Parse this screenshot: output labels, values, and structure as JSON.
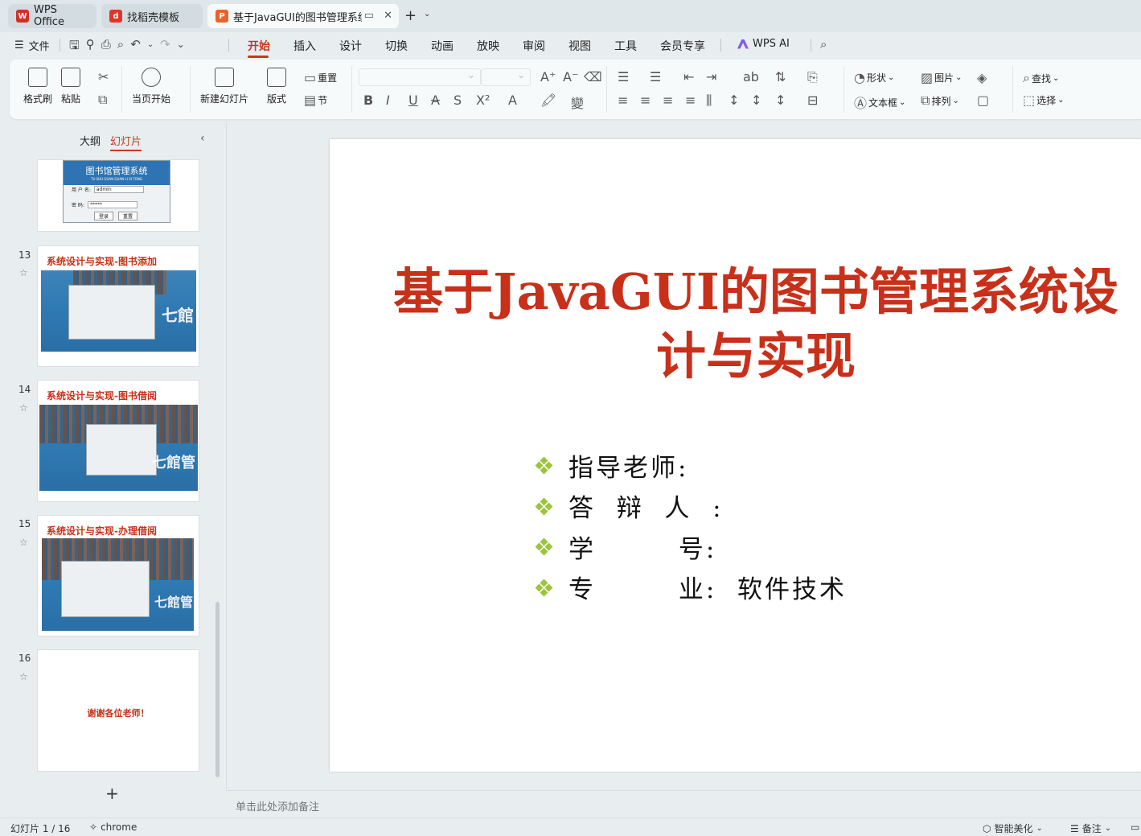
{
  "tabs": [
    {
      "label": "WPS Office",
      "icon": "wps-logo-icon",
      "color": "#d0302a"
    },
    {
      "label": "找稻壳模板",
      "icon": "docer-logo-icon",
      "color": "#e0342b"
    },
    {
      "label": "基于JavaGUI的图书管理系统",
      "icon": "presentation-logo-icon",
      "color": "#e8642c"
    }
  ],
  "menu": {
    "file_label": "文件",
    "items": [
      "开始",
      "插入",
      "设计",
      "切换",
      "动画",
      "放映",
      "审阅",
      "视图",
      "工具",
      "会员专享"
    ],
    "active": "开始",
    "ai_label": "WPS AI"
  },
  "ribbon": {
    "format_painter": "格式刷",
    "paste": "粘贴",
    "start_from_current": "当页开始",
    "new_slide": "新建幻灯片",
    "layout": "版式",
    "section": "节",
    "reset": "重置",
    "shape": "形状",
    "picture": "图片",
    "textbox": "文本框",
    "arrange": "排列",
    "find": "查找",
    "select": "选择"
  },
  "left_panel": {
    "tab_outline": "大纲",
    "tab_slides": "幻灯片",
    "thumbnails": [
      {
        "number": "",
        "title": "",
        "login_title": "图书馆管理系统",
        "login_sub": "TU SHU GUAN GUAN LI XI TONG",
        "user_label": "用 户 名:",
        "user_value": "admin",
        "pwd_label": "密    码:",
        "pwd_value": "*****",
        "btn_login": "登录",
        "btn_reset": "重置"
      },
      {
        "number": "13",
        "title": "系统设计与实现-图书添加"
      },
      {
        "number": "14",
        "title": "系统设计与实现-图书借阅"
      },
      {
        "number": "15",
        "title": "系统设计与实现-办理借阅"
      },
      {
        "number": "16",
        "title": "",
        "body": "谢谢各位老师！"
      }
    ]
  },
  "slide": {
    "title_line1": "基于JavaGUI的图书管理系统设",
    "title_line2": "计与实现",
    "bullets": [
      "指导老师:",
      "答  辩  人  :",
      "学        号:",
      "专        业:  软件技术"
    ],
    "title_color": "#c8301a",
    "bullet_color": "#9cc43c"
  },
  "notes_placeholder": "单击此处添加备注",
  "status": {
    "slide_counter": "幻灯片 1 / 16",
    "theme": "chrome",
    "smart_beautify": "智能美化",
    "notes": "备注"
  }
}
